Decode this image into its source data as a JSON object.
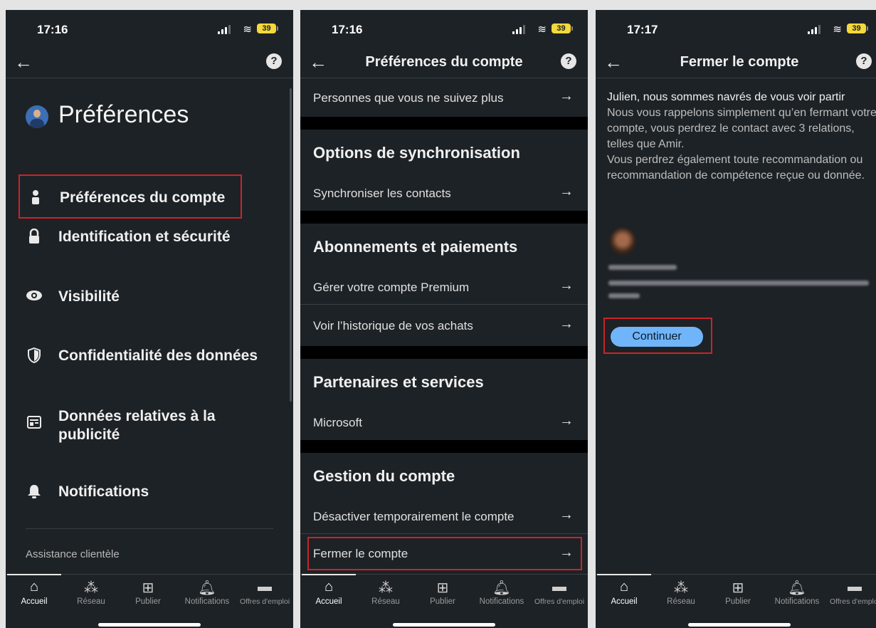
{
  "colors": {
    "bg": "#1d2226",
    "highlight": "#c9242a",
    "accent": "#70b5f9",
    "section_gap": "#000000"
  },
  "status_bars": [
    {
      "time": "17:16",
      "battery": "39"
    },
    {
      "time": "17:16",
      "battery": "39"
    },
    {
      "time": "17:17",
      "battery": "39"
    }
  ],
  "panel1": {
    "title": "Préférences",
    "menu": [
      {
        "label": "Préférences du compte",
        "icon": "person-icon"
      },
      {
        "label": "Identification et sécurité",
        "icon": "lock-icon"
      },
      {
        "label": "Visibilité",
        "icon": "eye-icon"
      },
      {
        "label": "Confidentialité des données",
        "icon": "shield-icon"
      },
      {
        "label": "Données relatives à la publicité",
        "icon": "ad-icon"
      },
      {
        "label": "Notifications",
        "icon": "bell-icon"
      }
    ],
    "assist": "Assistance clientèle"
  },
  "panel2": {
    "title": "Préférences du compte",
    "top_row": "Personnes que vous ne suivez plus",
    "sections": [
      {
        "title": "Options de synchronisation",
        "rows": [
          "Synchroniser les contacts"
        ]
      },
      {
        "title": "Abonnements et paiements",
        "rows": [
          "Gérer votre compte Premium",
          "Voir l’historique de vos achats"
        ]
      },
      {
        "title": "Partenaires et services",
        "rows": [
          "Microsoft"
        ]
      },
      {
        "title": "Gestion du compte",
        "rows": [
          "Désactiver temporairement le compte",
          "Fermer le compte"
        ]
      }
    ]
  },
  "panel3": {
    "title": "Fermer le compte",
    "lead": "Julien, nous sommes navrés de vous voir partir",
    "body": "Nous vous rappelons simplement qu’en fermant votre compte, vous perdrez le contact avec 3 relations, telles que Amir.",
    "body2": "Vous perdrez également toute recommandation ou recommandation de compétence reçue ou donnée.",
    "button": "Continuer"
  },
  "tabbar": [
    {
      "label": "Accueil",
      "icon": "home-icon",
      "active": true
    },
    {
      "label": "Réseau",
      "icon": "network-icon"
    },
    {
      "label": "Publier",
      "icon": "post-icon"
    },
    {
      "label": "Notifications",
      "icon": "bell-icon"
    },
    {
      "label": "Offres d'emploi",
      "icon": "briefcase-icon"
    }
  ]
}
